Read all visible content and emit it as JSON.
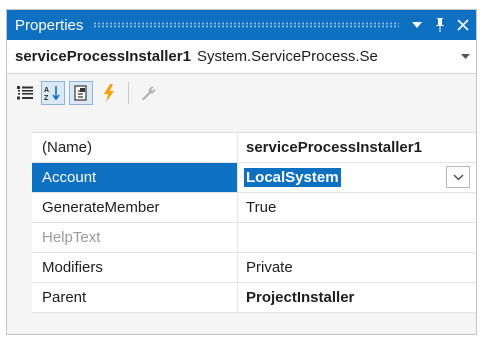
{
  "window": {
    "title": "Properties",
    "dropdown_glyph": "▼",
    "pin_glyph": "⊥",
    "close_glyph": "✕"
  },
  "object_selector": {
    "name": "serviceProcessInstaller1",
    "type": "System.ServiceProcess.Se"
  },
  "toolbar": {
    "buttons": [
      {
        "icon": "categorized-icon",
        "active": false
      },
      {
        "icon": "alphabetical-sort-icon",
        "active": true
      },
      {
        "icon": "properties-page-icon",
        "active": true
      },
      {
        "icon": "events-lightning-icon",
        "active": false
      },
      {
        "icon": "property-pages-wrench-icon",
        "active": false
      }
    ]
  },
  "grid": {
    "rows": [
      {
        "name": "(Name)",
        "value": "serviceProcessInstaller1"
      },
      {
        "name": "Account",
        "value": "LocalSystem"
      },
      {
        "name": "GenerateMember",
        "value": "True"
      },
      {
        "name": "HelpText",
        "value": ""
      },
      {
        "name": "Modifiers",
        "value": "Private"
      },
      {
        "name": "Parent",
        "value": "ProjectInstaller"
      }
    ]
  },
  "colors": {
    "accent": "#0e70c0",
    "lightning": "#f0a30a"
  }
}
